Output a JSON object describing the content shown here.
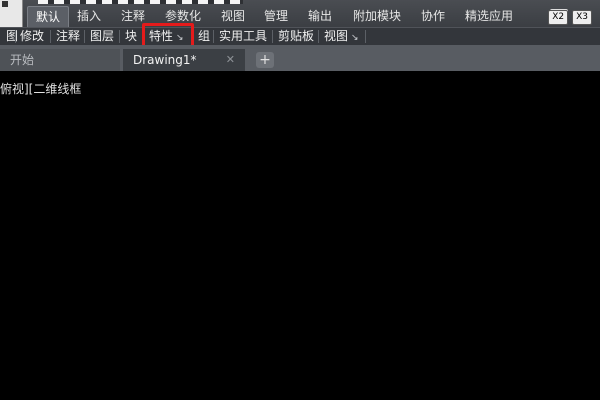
{
  "ribbon": {
    "tabs": [
      {
        "label": "默认",
        "active": true
      },
      {
        "label": "插入"
      },
      {
        "label": "注释"
      },
      {
        "label": "参数化"
      },
      {
        "label": "视图"
      },
      {
        "label": "管理"
      },
      {
        "label": "输出"
      },
      {
        "label": "附加模块"
      },
      {
        "label": "协作"
      },
      {
        "label": "精选应用"
      }
    ],
    "extra_buttons": [
      "X2",
      "X3"
    ]
  },
  "panels": [
    {
      "label": "图"
    },
    {
      "label": "修改"
    },
    {
      "label": "注释"
    },
    {
      "label": "图层"
    },
    {
      "label": "块"
    },
    {
      "label": "特性",
      "launcher": "↘",
      "highlighted": true
    },
    {
      "label": "组"
    },
    {
      "label": "实用工具"
    },
    {
      "label": "剪贴板"
    },
    {
      "label": "视图",
      "launcher": "↘"
    }
  ],
  "file_tabs": [
    {
      "label": "开始"
    },
    {
      "label": "Drawing1*",
      "active": true,
      "close": "✕"
    }
  ],
  "add_tab_label": "+",
  "viewport": {
    "label": "俯视][二维线框"
  },
  "colors": {
    "highlight": "#e51b1b",
    "canvas": "#000000"
  }
}
